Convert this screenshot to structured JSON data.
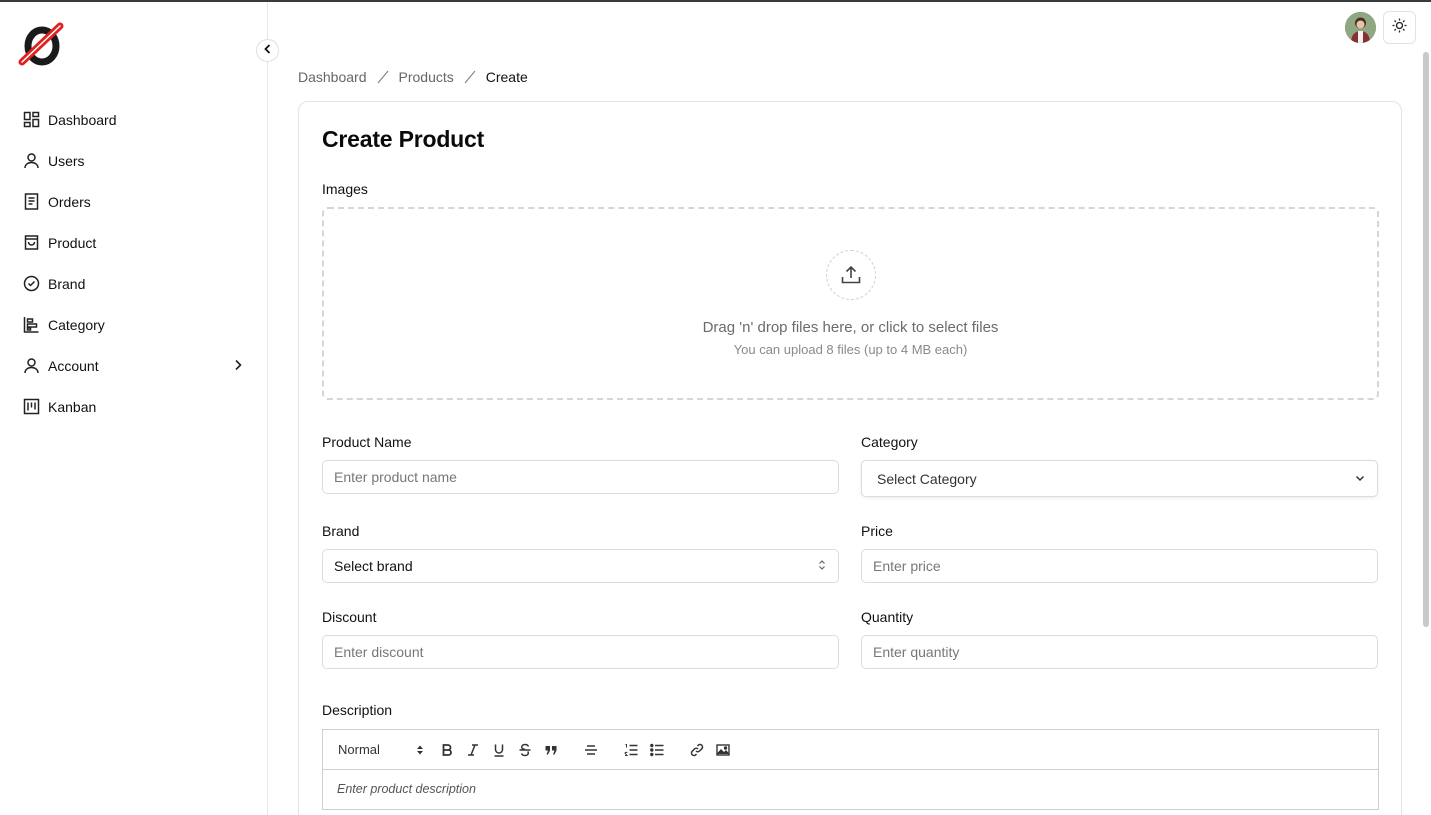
{
  "sidebar": {
    "items": [
      {
        "label": "Dashboard"
      },
      {
        "label": "Users"
      },
      {
        "label": "Orders"
      },
      {
        "label": "Product"
      },
      {
        "label": "Brand"
      },
      {
        "label": "Category"
      },
      {
        "label": "Account"
      },
      {
        "label": "Kanban"
      }
    ]
  },
  "breadcrumb": {
    "items": [
      "Dashboard",
      "Products"
    ],
    "current": "Create"
  },
  "page": {
    "title": "Create Product"
  },
  "form": {
    "images_label": "Images",
    "dropzone_title": "Drag 'n' drop files here, or click to select files",
    "dropzone_hint": "You can upload 8 files (up to 4 MB each)",
    "product_name_label": "Product Name",
    "product_name_placeholder": "Enter product name",
    "category_label": "Category",
    "category_value": "Select Category",
    "brand_label": "Brand",
    "brand_value": "Select brand",
    "price_label": "Price",
    "price_placeholder": "Enter price",
    "discount_label": "Discount",
    "discount_placeholder": "Enter discount",
    "quantity_label": "Quantity",
    "quantity_placeholder": "Enter quantity",
    "description_label": "Description",
    "editor": {
      "format_value": "Normal",
      "placeholder": "Enter product description"
    }
  },
  "colors": {
    "brand_red": "#e02020",
    "text": "#111111",
    "muted": "#6b6b6b",
    "border": "#dcdcdc"
  }
}
